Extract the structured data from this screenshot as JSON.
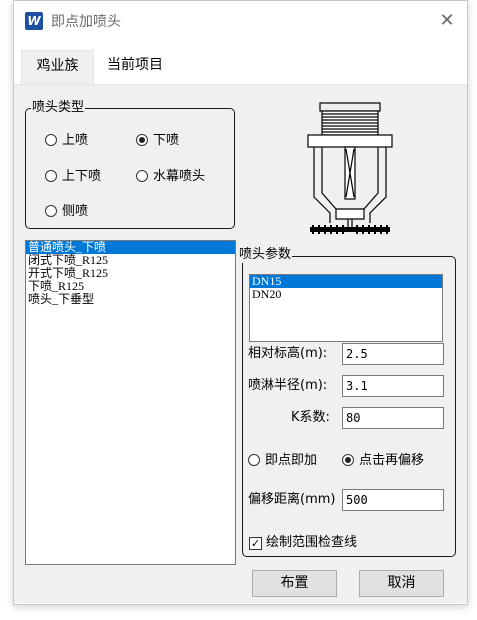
{
  "window": {
    "title": "即点加喷头",
    "app_icon_label": "W",
    "close_glyph": "✕"
  },
  "tabs": [
    {
      "label": "鸡业族",
      "active": true
    },
    {
      "label": "当前项目",
      "active": false
    }
  ],
  "sprinkler_type": {
    "legend": "喷头类型",
    "options": [
      {
        "label": "上喷",
        "selected": false
      },
      {
        "label": "下喷",
        "selected": true
      },
      {
        "label": "上下喷",
        "selected": false
      },
      {
        "label": "水幕喷头",
        "selected": false
      },
      {
        "label": "侧喷",
        "selected": false
      }
    ]
  },
  "family_list": {
    "items": [
      {
        "label": "普通喷头_下喷",
        "selected": true
      },
      {
        "label": "闭式下喷_R125",
        "selected": false
      },
      {
        "label": "开式下喷_R125",
        "selected": false
      },
      {
        "label": "下喷_R125",
        "selected": false
      },
      {
        "label": "喷头_下垂型",
        "selected": false
      }
    ]
  },
  "params": {
    "legend": "喷头参数",
    "sizes": [
      {
        "label": "DN15",
        "selected": true
      },
      {
        "label": "DN20",
        "selected": false
      }
    ],
    "relative_elevation": {
      "label": "相对标高(m):",
      "value": "2.5"
    },
    "spray_radius": {
      "label": "喷淋半径(m):",
      "value": "3.1"
    },
    "k_factor": {
      "label": "K系数:",
      "value": "80"
    },
    "mode_options": [
      {
        "label": "即点即加",
        "selected": false
      },
      {
        "label": "点击再偏移",
        "selected": true
      }
    ],
    "offset_distance": {
      "label": "偏移距离(mm)",
      "value": "500"
    },
    "draw_check_lines": {
      "label": "绘制范围检查线",
      "checked": true
    }
  },
  "buttons": {
    "place": "布置",
    "cancel": "取消"
  },
  "colors": {
    "selection": "#0078d7",
    "panel": "#f0f0f0"
  }
}
